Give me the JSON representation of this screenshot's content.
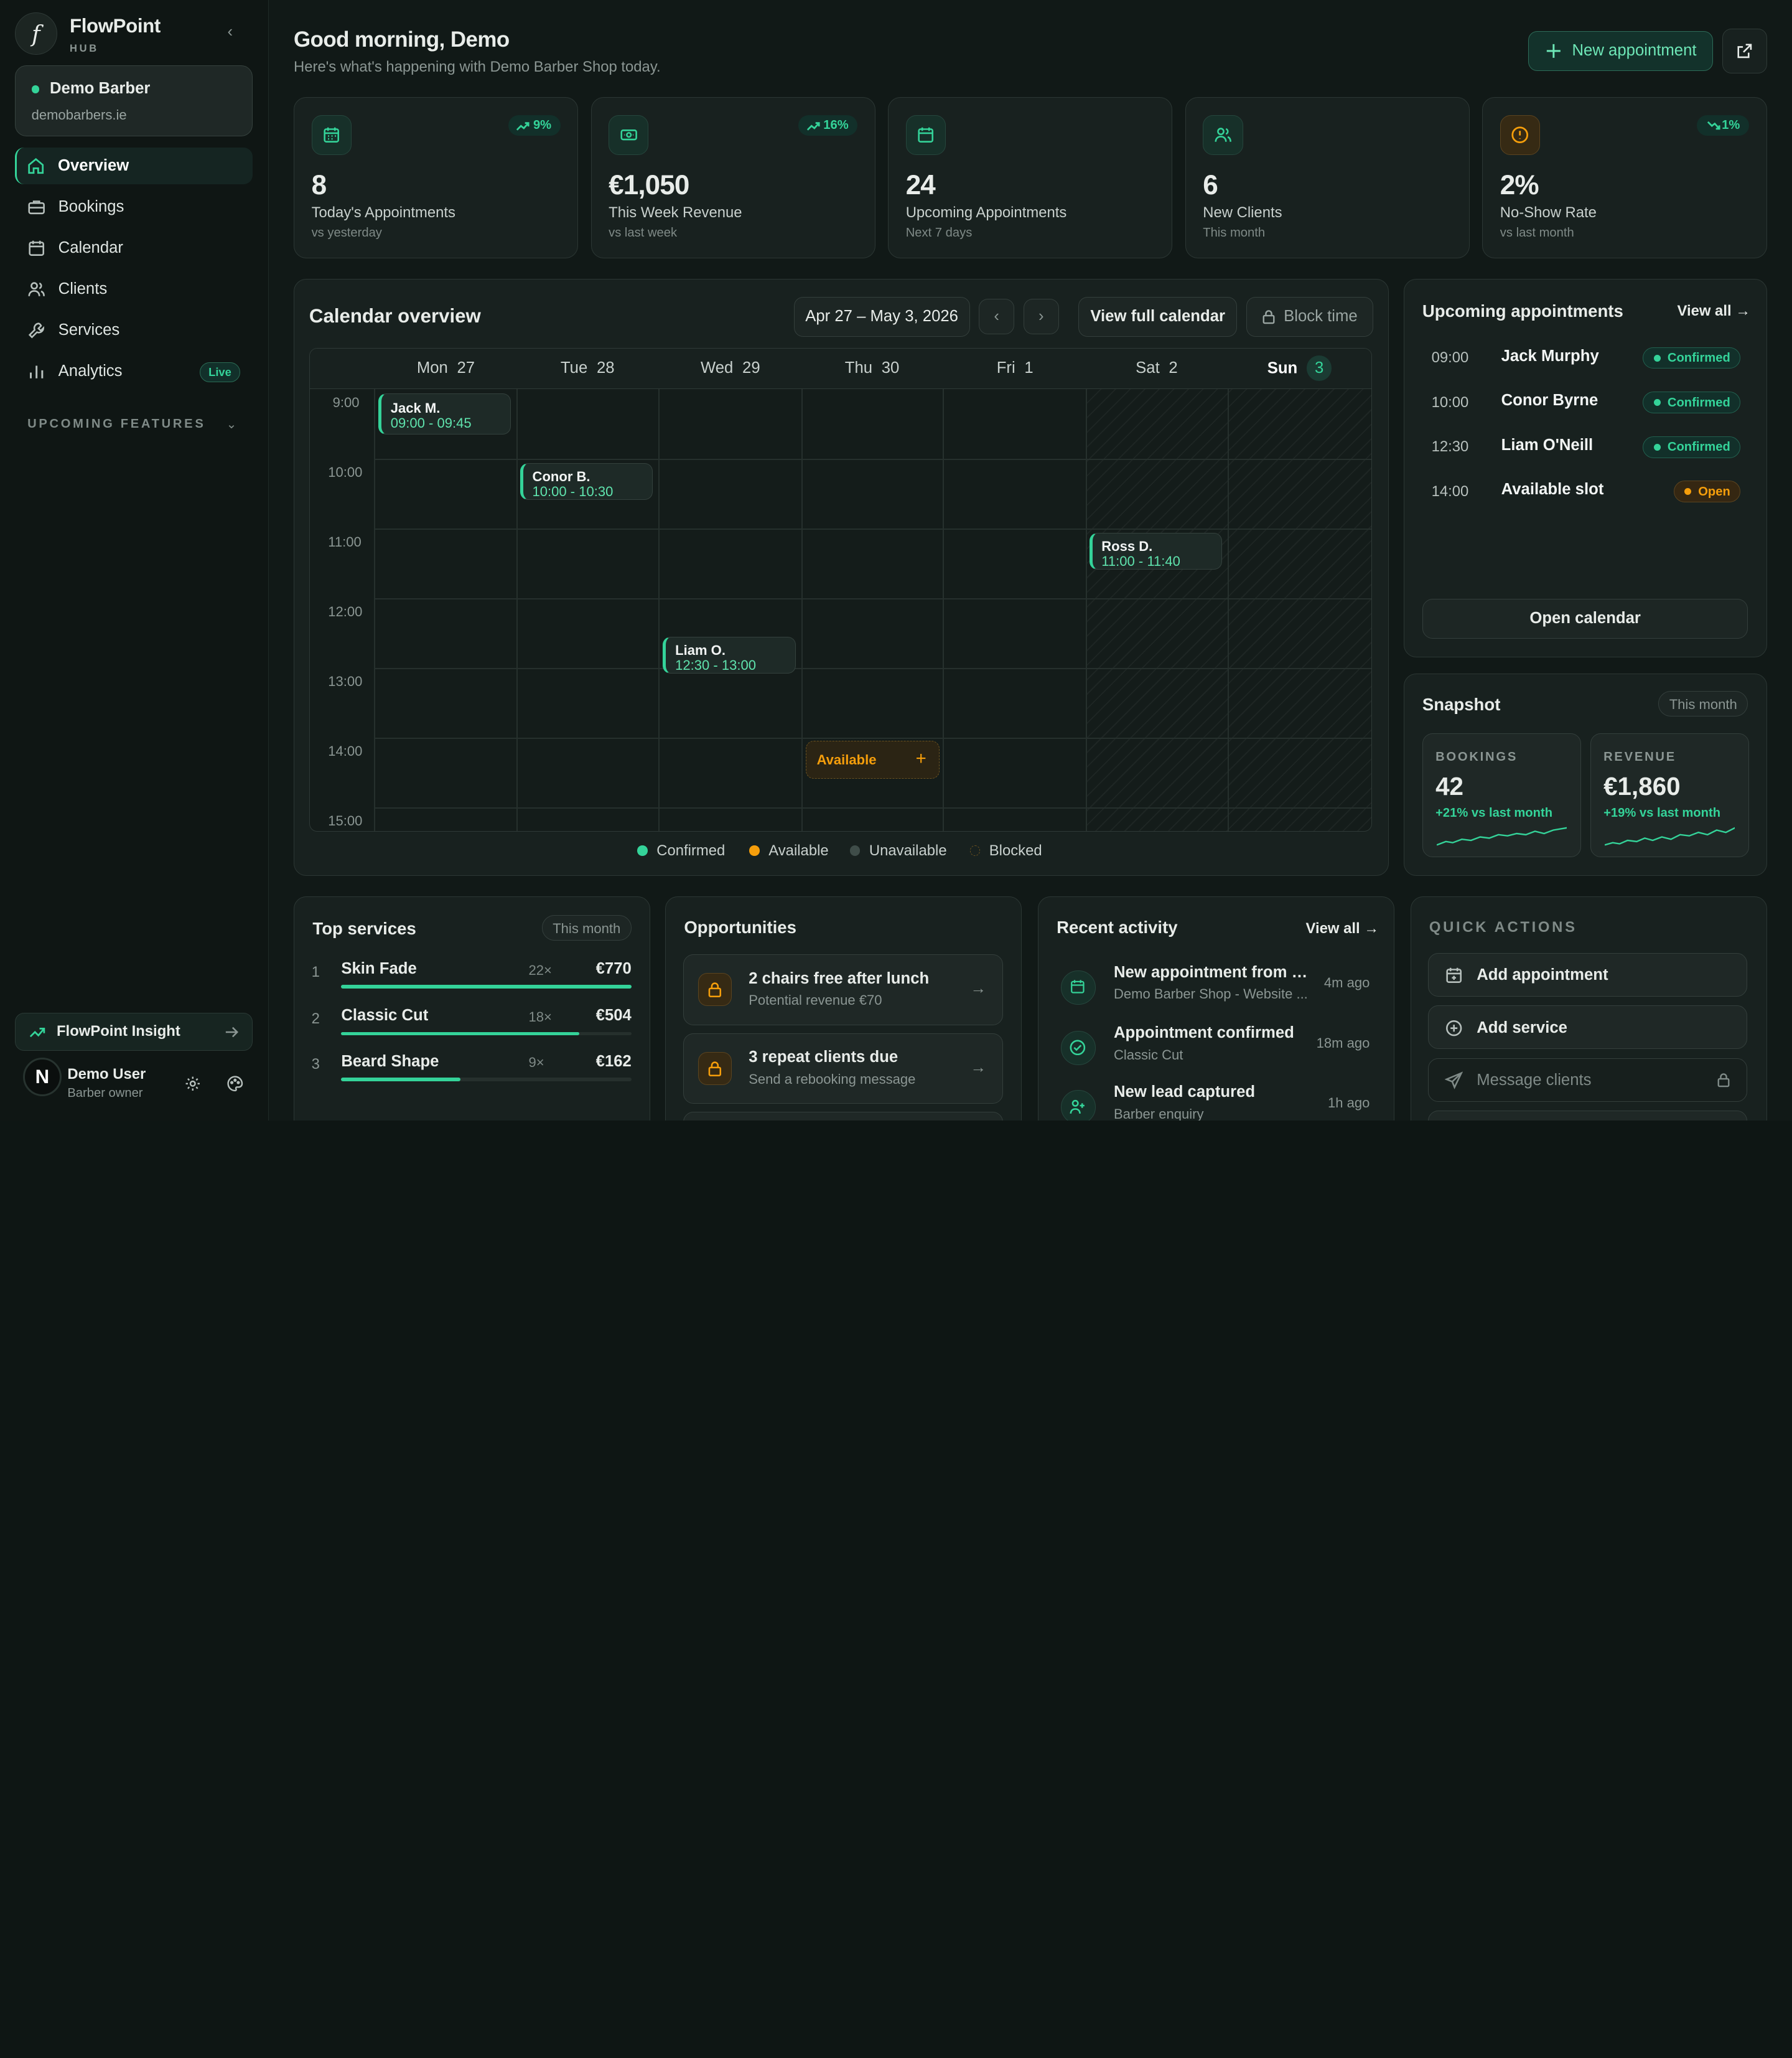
{
  "sidebar": {
    "brand": "FlowPoint",
    "brand_sub": "HUB",
    "shop": {
      "name": "Demo Barber",
      "url": "demobarbers.ie"
    },
    "nav": [
      {
        "label": "Overview",
        "icon": "home-icon",
        "active": true
      },
      {
        "label": "Bookings",
        "icon": "briefcase-icon"
      },
      {
        "label": "Calendar",
        "icon": "calendar-icon"
      },
      {
        "label": "Clients",
        "icon": "users-icon"
      },
      {
        "label": "Services",
        "icon": "wrench-icon"
      },
      {
        "label": "Analytics",
        "icon": "bar-chart-icon",
        "badge": "Live"
      }
    ],
    "upcoming_features": "UPCOMING FEATURES",
    "insight": "FlowPoint Insight",
    "user": {
      "initial": "N",
      "name": "Demo User",
      "role": "Barber owner"
    }
  },
  "header": {
    "greeting": "Good morning, Demo",
    "subtitle": "Here's what's happening with Demo Barber Shop today.",
    "new_button": "New appointment"
  },
  "stats": [
    {
      "value": "8",
      "label": "Today's Appointments",
      "sub": "vs yesterday",
      "trend": "9%",
      "icon": "calendar-icon"
    },
    {
      "value": "€1,050",
      "label": "This Week Revenue",
      "sub": "vs last week",
      "trend": "16%",
      "icon": "cash-icon"
    },
    {
      "value": "24",
      "label": "Upcoming Appointments",
      "sub": "Next 7 days",
      "trend": "",
      "icon": "calendar-icon"
    },
    {
      "value": "6",
      "label": "New Clients",
      "sub": "This month",
      "trend": "",
      "icon": "users-icon"
    },
    {
      "value": "2%",
      "label": "No-Show Rate",
      "sub": "vs last month",
      "trend": "1%",
      "icon": "alert-icon"
    }
  ],
  "calendar": {
    "title": "Calendar overview",
    "range": "Apr 27 – May 3, 2026",
    "view_full": "View full calendar",
    "block_time": "Block time",
    "days": [
      {
        "day": "Mon",
        "num": "27"
      },
      {
        "day": "Tue",
        "num": "28"
      },
      {
        "day": "Wed",
        "num": "29"
      },
      {
        "day": "Thu",
        "num": "30"
      },
      {
        "day": "Fri",
        "num": "1"
      },
      {
        "day": "Sat",
        "num": "2"
      },
      {
        "day": "Sun",
        "num": "3",
        "today": true
      }
    ],
    "times": [
      "9:00",
      "10:00",
      "11:00",
      "12:00",
      "13:00",
      "14:00",
      "15:00"
    ],
    "events": [
      {
        "name": "Jack M.",
        "time": "09:00 - 09:45"
      },
      {
        "name": "Conor B.",
        "time": "10:00 - 10:30"
      },
      {
        "name": "Ross D.",
        "time": "11:00 - 11:40"
      },
      {
        "name": "Liam O.",
        "time": "12:30 - 13:00"
      }
    ],
    "available_label": "Available",
    "legend": [
      "Confirmed",
      "Available",
      "Unavailable",
      "Blocked"
    ]
  },
  "upcoming": {
    "title": "Upcoming appointments",
    "view_all": "View all →",
    "open_calendar": "Open calendar",
    "rows": [
      {
        "time": "09:00",
        "name": "Jack Murphy",
        "status": "Confirmed"
      },
      {
        "time": "10:00",
        "name": "Conor Byrne",
        "status": "Confirmed"
      },
      {
        "time": "12:30",
        "name": "Liam O'Neill",
        "status": "Confirmed"
      },
      {
        "time": "14:00",
        "name": "Available slot",
        "status": "Open"
      }
    ]
  },
  "snapshot": {
    "title": "Snapshot",
    "period": "This month",
    "bookings": {
      "label": "BOOKINGS",
      "value": "42",
      "change": "+21% vs last month"
    },
    "revenue": {
      "label": "REVENUE",
      "value": "€1,860",
      "change": "+19% vs last month"
    }
  },
  "top_services": {
    "title": "Top services",
    "period": "This month",
    "rows": [
      {
        "rank": "1",
        "name": "Skin Fade",
        "count": "22×",
        "price": "€770",
        "share": 1.0
      },
      {
        "rank": "2",
        "name": "Classic Cut",
        "count": "18×",
        "price": "€504",
        "share": 0.82
      },
      {
        "rank": "3",
        "name": "Beard Shape",
        "count": "9×",
        "price": "€162",
        "share": 0.41
      }
    ]
  },
  "opportunities": {
    "title": "Opportunities",
    "rows": [
      {
        "title": "2 chairs free after lunch",
        "sub": "Potential revenue €70"
      },
      {
        "title": "3 repeat clients due",
        "sub": "Send a rebooking message"
      }
    ]
  },
  "activity": {
    "title": "Recent activity",
    "view_all": "View all →",
    "rows": [
      {
        "title": "New appointment from w...",
        "sub": "Demo Barber Shop - Website ...",
        "time": "4m ago",
        "icon": "calendar-icon"
      },
      {
        "title": "Appointment confirmed",
        "sub": "Classic Cut",
        "time": "18m ago",
        "icon": "check-circle-icon"
      },
      {
        "title": "New lead captured",
        "sub": "Barber enquiry",
        "time": "1h ago",
        "icon": "user-plus-icon"
      }
    ]
  },
  "quick_actions": {
    "title": "QUICK ACTIONS",
    "items": [
      {
        "label": "Add appointment",
        "icon": "calendar-plus-icon"
      },
      {
        "label": "Add service",
        "icon": "plus-circle-icon"
      },
      {
        "label": "Message clients",
        "icon": "send-icon",
        "locked": true
      }
    ]
  },
  "colors": {
    "accent": "#34d399",
    "warning": "#f59e0b",
    "background": "#111917",
    "card": "#18211f"
  }
}
